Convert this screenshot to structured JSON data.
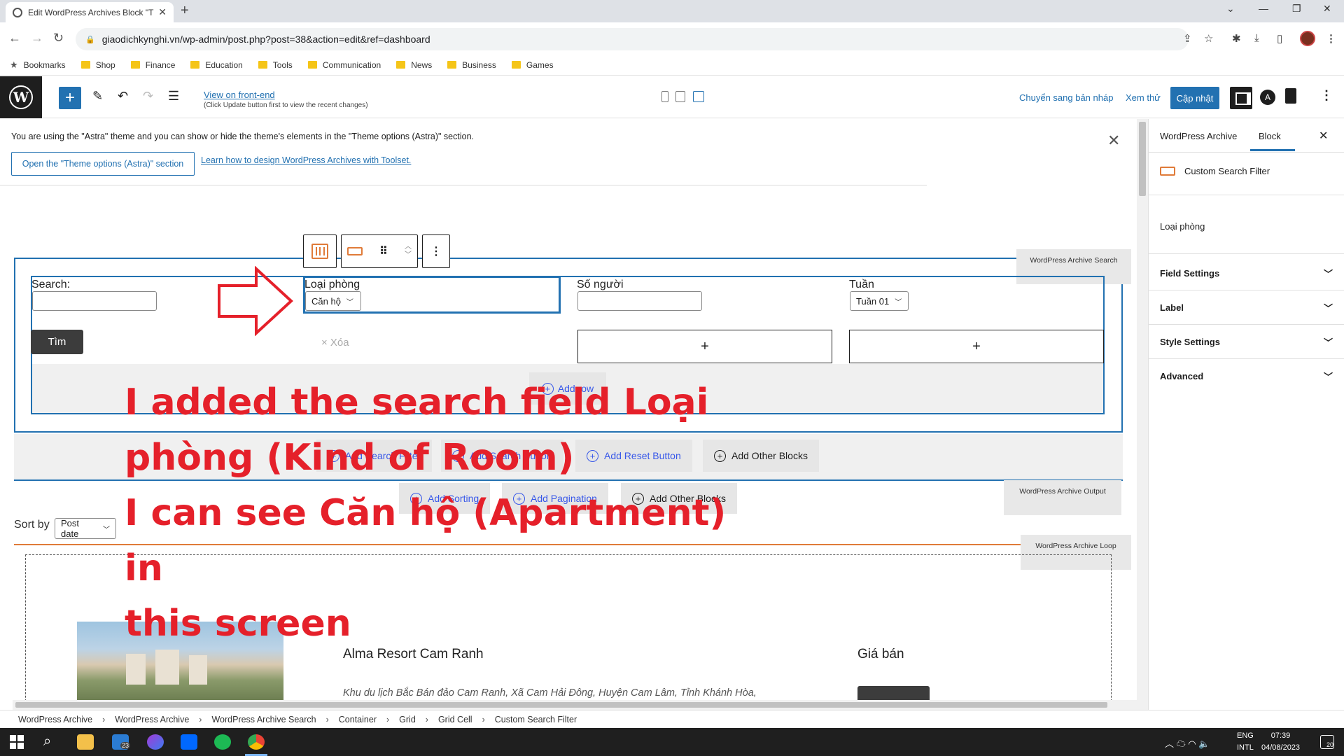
{
  "browser": {
    "tab_title": "Edit WordPress Archives Block \"T",
    "url": "giaodichkynghi.vn/wp-admin/post.php?post=38&action=edit&ref=dashboard",
    "bookmarks": [
      "Bookmarks",
      "Shop",
      "Finance",
      "Education",
      "Tools",
      "Communication",
      "News",
      "Business",
      "Games"
    ]
  },
  "editor": {
    "view_front_end": "View on front-end",
    "view_note": "(Click Update button first to view the recent changes)",
    "switch_draft": "Chuyển sang bản nháp",
    "preview": "Xem thử",
    "update": "Cập nhật"
  },
  "notice": {
    "text": "You are using the \"Astra\" theme and you can show or hide the theme's elements in the \"Theme options (Astra)\" section.",
    "button": "Open the \"Theme options (Astra)\" section",
    "link": "Learn how to design WordPress Archives with Toolset."
  },
  "canvas": {
    "search_block_label": "WordPress Archive Search",
    "search_label": "Search:",
    "room_label": "Loại phòng",
    "room_value": "Căn hộ",
    "people_label": "Số người",
    "week_label": "Tuần",
    "week_value": "Tuần 01",
    "search_button": "Tìm",
    "clear_link": "× Xóa",
    "plus": "+",
    "add_row": "Add row",
    "add_search_filter": "Add Search Filter",
    "add_search_button": "Add Search Button",
    "add_reset_button": "Add Reset Button",
    "add_other_blocks": "Add Other Blocks",
    "output_label": "WordPress Archive Output",
    "add_sorting": "Add Sorting",
    "add_pagination": "Add Pagination",
    "sort_by": "Sort by",
    "sort_value": "Post date",
    "loop_label": "WordPress Archive Loop",
    "item_title": "Alma Resort Cam Ranh",
    "item_desc": "Khu du lịch Bắc Bán đảo Cam Ranh, Xã Cam Hải Đông, Huyện Cam Lâm, Tỉnh Khánh Hòa,",
    "price_label": "Giá bán"
  },
  "annotation": {
    "lines": [
      "I added the search field Loại",
      "phòng (Kind of Room)",
      "I can see Căn hộ (Apartment) in",
      "this screen"
    ]
  },
  "sidebar": {
    "tab_archive": "WordPress Archive",
    "tab_block": "Block",
    "block_name": "Custom Search Filter",
    "field_name": "Loại phòng",
    "panels": [
      "Field Settings",
      "Label",
      "Style Settings",
      "Advanced"
    ]
  },
  "breadcrumb": [
    "WordPress Archive",
    "WordPress Archive",
    "WordPress Archive Search",
    "Container",
    "Grid",
    "Grid Cell",
    "Custom Search Filter"
  ],
  "taskbar": {
    "badge_count": "23",
    "lang1": "ENG",
    "lang2": "INTL",
    "time": "07:39",
    "date": "04/08/2023",
    "notif_count": "20"
  },
  "colors": {
    "wp_blue": "#2271b1",
    "annotation_red": "#e5202a",
    "loop_orange": "#e07b39"
  }
}
